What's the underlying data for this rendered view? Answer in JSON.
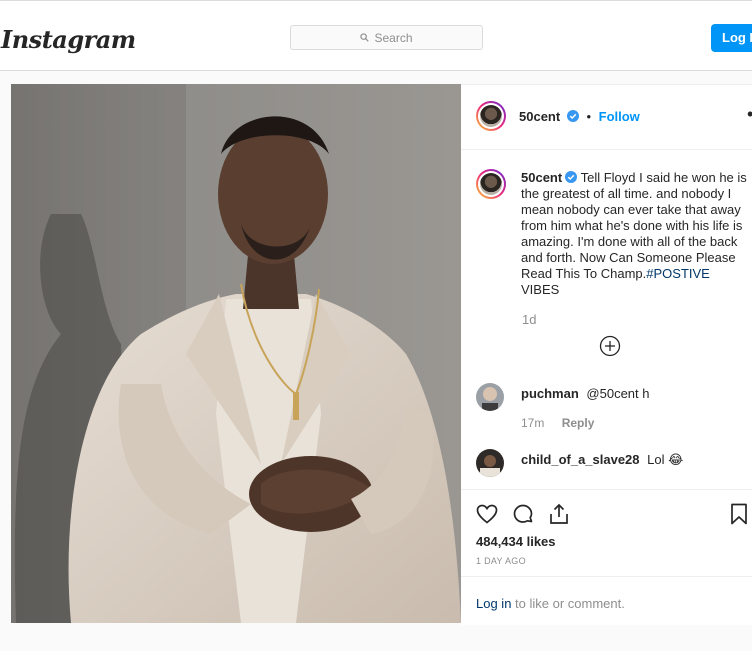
{
  "header": {
    "logo": "Instagram",
    "search_placeholder": "Search",
    "login_label": "Log In"
  },
  "post": {
    "username": "50cent",
    "follow_label": "Follow",
    "separator": "•",
    "more_label": "•••",
    "caption": {
      "text": "Tell Floyd I said he won he is the greatest of all time. and nobody I mean nobody can ever take that away from him what he's done with his life is amazing. I'm done with all of the back and forth. Now Can Someone Please Read This To Champ.",
      "hashtag": "#POSTIVE",
      "tail": " VIBES"
    },
    "caption_time": "1d",
    "comments": [
      {
        "username": "puchman",
        "text": "@50cent h",
        "time": "17m",
        "reply_label": "Reply"
      },
      {
        "username": "child_of_a_slave28",
        "text": "Lol 😂",
        "time": "",
        "reply_label": ""
      }
    ],
    "likes": "484,434 likes",
    "posted_ago": "1 DAY AGO",
    "login_prompt": {
      "link": "Log in",
      "rest": " to like or comment."
    }
  },
  "colors": {
    "accent": "#0095f6",
    "link": "#00376b",
    "muted": "#8e8e8e",
    "verified": "#3897f0"
  },
  "icons": [
    "search-icon",
    "verified-badge-icon",
    "more-options-icon",
    "add-comment-icon",
    "heart-icon",
    "comment-icon",
    "share-icon",
    "bookmark-icon"
  ]
}
